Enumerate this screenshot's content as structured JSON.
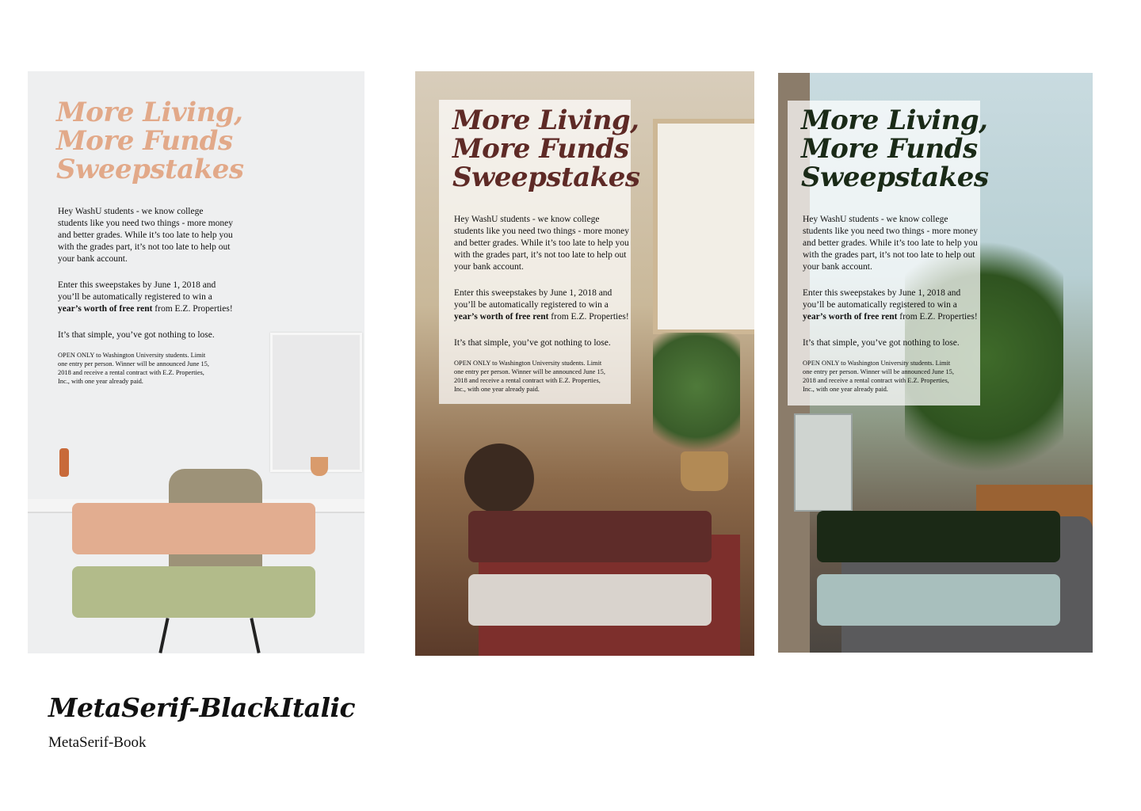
{
  "posters": [
    {
      "headline_lines": [
        "More Living,",
        "More Funds",
        "Sweepstakes"
      ],
      "headline_color": "#e2a989",
      "paragraph1": "Hey WashU students - we know college students like you need two things - more money and better grades. While it’s too late to help you with the grades part, it’s not too late to help out your bank account.",
      "paragraph2_before": "Enter this sweepstakes by June 1, 2018 and you’ll be automatically registered to win a ",
      "paragraph2_bold": "year’s worth of free rent",
      "paragraph2_after": " from E.Z. Properties!",
      "paragraph3": "It’s that simple, you’ve got nothing to lose.",
      "fine_print": "OPEN ONLY to Washington University students. Limit one entry per person. Winner will be announced June 15, 2018 and receive a rental contract with E.Z. Properties, Inc., with one year already paid.",
      "button_primary_color": "#e2ad90",
      "button_secondary_color": "#b2bb8a"
    },
    {
      "headline_lines": [
        "More Living,",
        "More Funds",
        "Sweepstakes"
      ],
      "headline_color": "#5e2a26",
      "paragraph1": "Hey WashU students - we know college students like you need two things - more money and better grades. While it’s too late to help you with the grades part, it’s not too late to help out your bank account.",
      "paragraph2_before": "Enter this sweepstakes by June 1, 2018 and you’ll be automatically registered to win a ",
      "paragraph2_bold": "year’s worth of free rent",
      "paragraph2_after": " from E.Z. Properties!",
      "paragraph3": "It’s that simple, you’ve got nothing to lose.",
      "fine_print": "OPEN ONLY to Washington University students. Limit one entry per person. Winner will be announced June 15, 2018 and receive a rental contract with E.Z. Properties, Inc., with one year already paid.",
      "button_primary_color": "#5e2c29",
      "button_secondary_color": "#d9d3cd"
    },
    {
      "headline_lines": [
        "More Living,",
        "More Funds",
        "Sweepstakes"
      ],
      "headline_color": "#1a2a17",
      "paragraph1": "Hey WashU students - we know college students like you need two things - more money and better grades. While it’s too late to help you with the grades part, it’s not too late to help out your bank account.",
      "paragraph2_before": "Enter this sweepstakes by June 1, 2018 and you’ll be automatically registered to win a ",
      "paragraph2_bold": "year’s worth of free rent",
      "paragraph2_after": " from E.Z. Properties!",
      "paragraph3": "It’s that simple, you’ve got nothing to lose.",
      "fine_print": "OPEN ONLY to Washington University students. Limit one entry per person. Winner will be announced June 15, 2018 and receive a rental contract with E.Z. Properties, Inc., with one year already paid.",
      "button_primary_color": "#1b2916",
      "button_secondary_color": "#a8bfbd"
    }
  ],
  "caption": {
    "title": "MetaSerif-BlackItalic",
    "subtitle": "MetaSerif-Book"
  }
}
